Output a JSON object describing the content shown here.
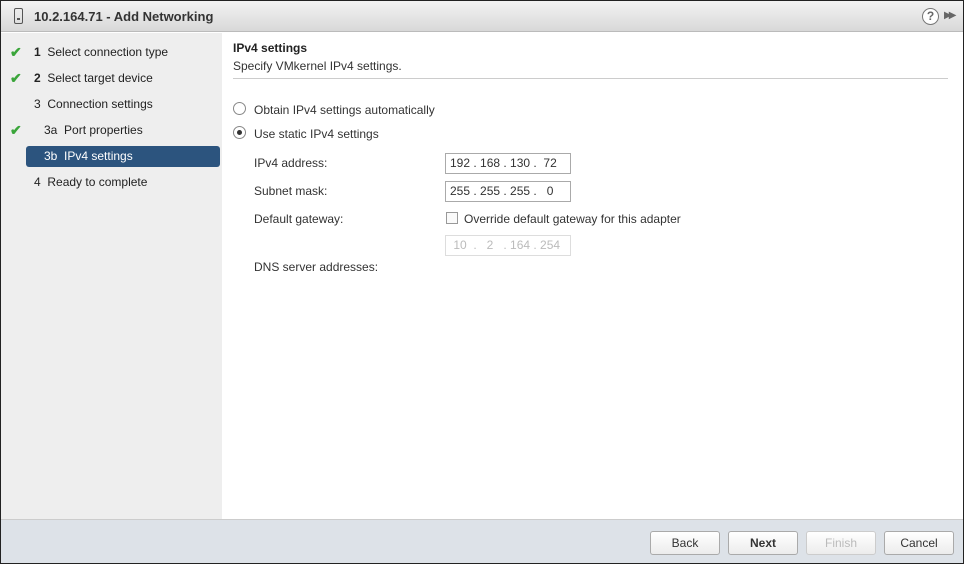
{
  "title": "10.2.164.71 - Add Networking",
  "steps": [
    {
      "num": "1",
      "label": "Select connection type",
      "done": true
    },
    {
      "num": "2",
      "label": "Select target device",
      "done": true
    },
    {
      "num": "3",
      "label": "Connection settings",
      "done": false
    },
    {
      "num": "3a",
      "label": "Port properties",
      "done": true
    },
    {
      "num": "3b",
      "label": "IPv4 settings",
      "done": false,
      "active": true
    },
    {
      "num": "4",
      "label": "Ready to complete",
      "done": false
    }
  ],
  "main": {
    "heading": "IPv4 settings",
    "subheading": "Specify VMkernel IPv4 settings.",
    "radio_auto": "Obtain IPv4 settings automatically",
    "radio_static": "Use static IPv4 settings",
    "ipv4_label": "IPv4 address:",
    "ipv4_value": "192 . 168 . 130 .  72",
    "subnet_label": "Subnet mask:",
    "subnet_value": "255 . 255 . 255 .   0",
    "gateway_label": "Default gateway:",
    "override_label": "Override default gateway for this adapter",
    "gateway_value": " 10  .   2   . 164 . 254",
    "dns_label": "DNS server addresses:"
  },
  "footer": {
    "back": "Back",
    "next": "Next",
    "finish": "Finish",
    "cancel": "Cancel"
  },
  "check": "✔",
  "help": "?",
  "expand": "▶▶"
}
